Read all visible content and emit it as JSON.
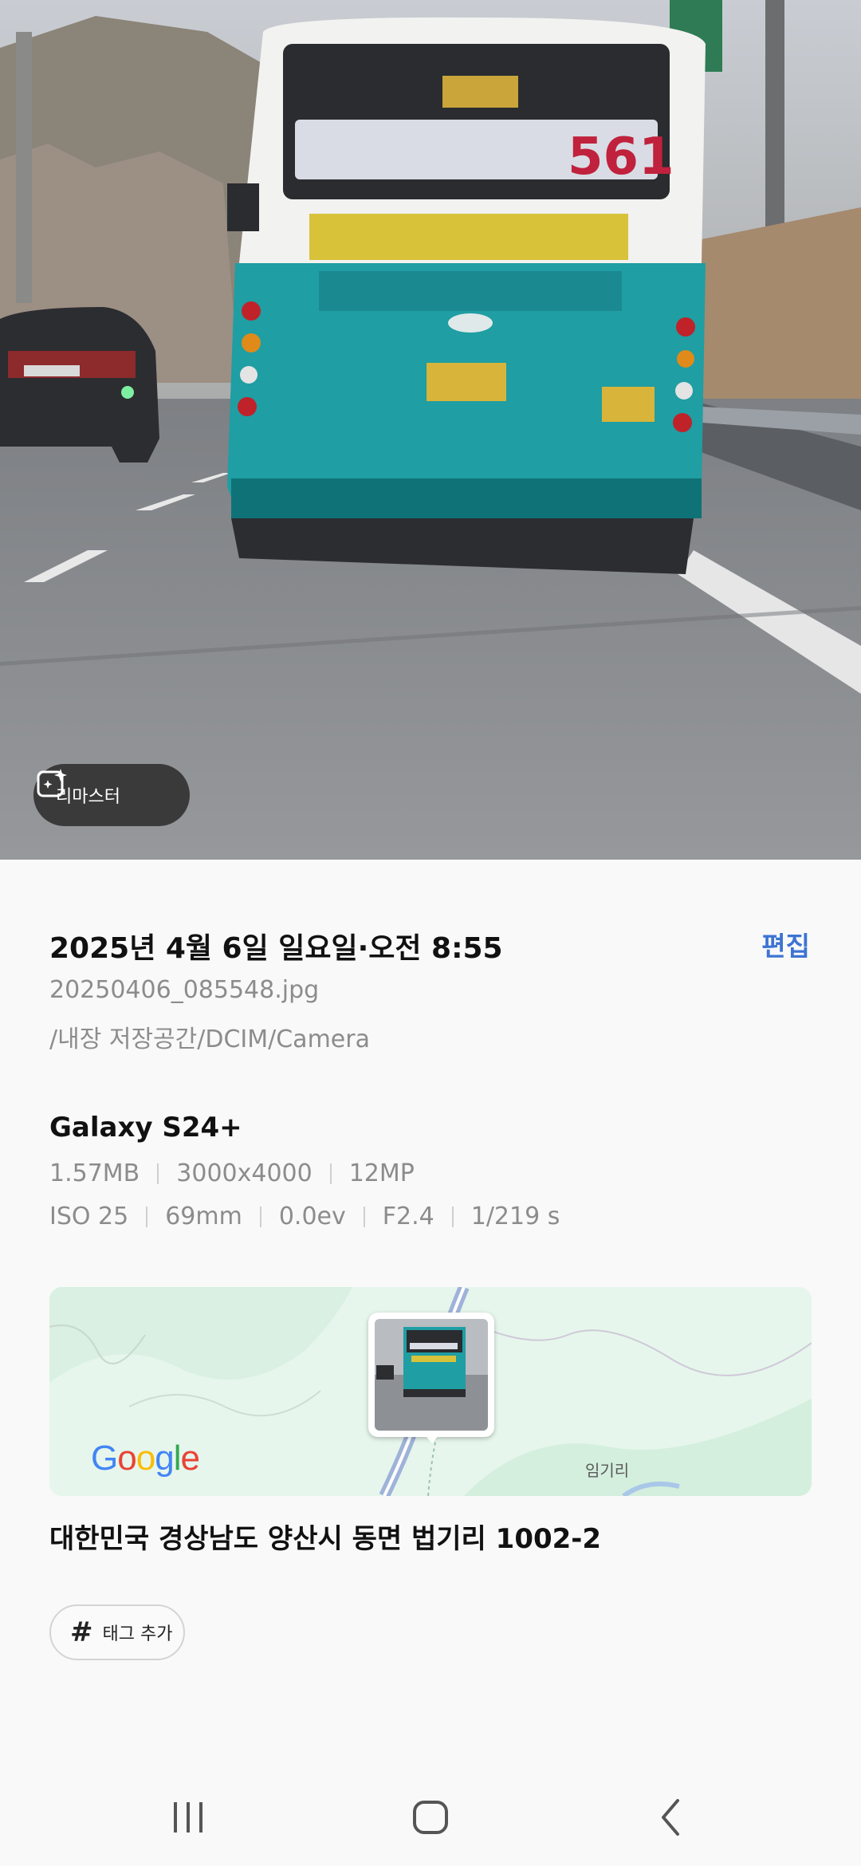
{
  "photo": {
    "alt": "Turquoise city bus on highway",
    "bus_route_number": "561",
    "remaster_label": "리마스터"
  },
  "details": {
    "date_time": "2025년 4월 6일 일요일·오전 8:55",
    "edit_label": "편집",
    "file_name": "20250406_085548.jpg",
    "file_path": "/내장 저장공간/DCIM/Camera",
    "device": "Galaxy S24+",
    "specs_row1": [
      "1.57MB",
      "3000x4000",
      "12MP"
    ],
    "specs_row2": [
      "ISO 25",
      "69mm",
      "0.0ev",
      "F2.4",
      "1/219 s"
    ]
  },
  "map": {
    "provider_logo": "Google",
    "place_label": "임기리"
  },
  "location": {
    "address": "대한민국 경상남도 양산시 동면 법기리 1002-2"
  },
  "tag": {
    "hash_symbol": "#",
    "label": "태그 추가"
  },
  "navbar": {
    "recents_icon": "recent-apps-icon",
    "home_icon": "home-icon",
    "back_icon": "back-icon"
  },
  "colors": {
    "accent": "#3d74d4",
    "bus_body": "#1f9ea3",
    "map_bg": "#e6f6ec"
  }
}
